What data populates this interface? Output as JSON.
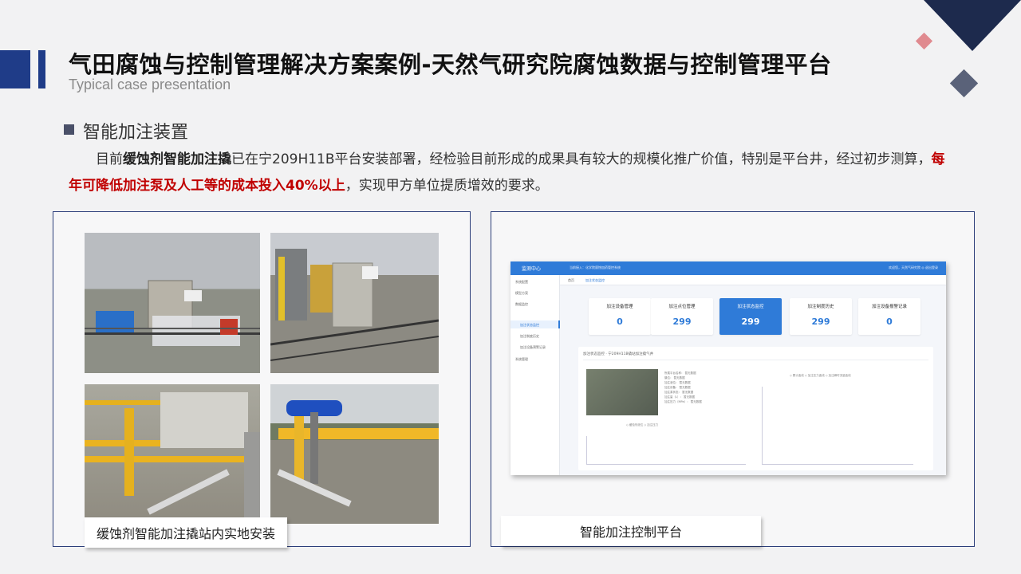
{
  "header": {
    "title": "气田腐蚀与控制管理解决方案案例-天然气研究院腐蚀数据与控制管理平台",
    "subtitle": "Typical case presentation"
  },
  "section": {
    "title": "智能加注装置"
  },
  "paragraph": {
    "p1": "目前",
    "p2": "缓蚀剂智能加注撬",
    "p3": "已在宁209H11B平台安装部署，经检验目前形成的成果具有较大的规模化推广价值，特别是平台井，经过初步测算，",
    "p4": "每年可降低加注泵及人工等的成本投入40%以上",
    "p5": "，实现甲方单位提质增效的要求。"
  },
  "left_panel": {
    "caption": "缓蚀剂智能加注撬站内实地安装"
  },
  "right_panel": {
    "caption": "智能加注控制平台"
  },
  "screenshot": {
    "brand": "监测中心",
    "nav": "当前接入：化学院腐蚀加药管控系统",
    "user": "欢迎您，天然气研究院  ◎ 退出登录",
    "sidebar": [
      "系统配置",
      "模型方案",
      "数据监控",
      "加注状态监控",
      "加注制度历史",
      "加注设备预警记录",
      "系统管理"
    ],
    "tabs": [
      "首页",
      "加注状态监控"
    ],
    "cards": [
      {
        "title": "加注设备管理",
        "value": "0"
      },
      {
        "title": "加注点位管理",
        "value": "299"
      },
      {
        "title": "加注状态监控",
        "value": "299"
      },
      {
        "title": "加注制度历史",
        "value": "299"
      },
      {
        "title": "加注设备报警记录",
        "value": "0"
      }
    ],
    "monitor_title": "加注状态监控 · 宁209H11B撬站加注撬气井",
    "monitor_info": [
      "所属平台名称：  暂无数据",
      "撬位：  暂无数据",
      "加注液位：  暂无数据",
      "加注设备：  暂无数据",
      "加注泵状态：  暂无数据",
      "加注量（L）：  暂无数据",
      "加注压力（MPa）：  暂无数据"
    ],
    "legend_1": "◇ 缓蚀剂液位  ◇ 加注压力",
    "legend_2": "◇ 累计曲线  ◇ 加注压力曲线  ◇ 加注瞬时流量曲线"
  }
}
